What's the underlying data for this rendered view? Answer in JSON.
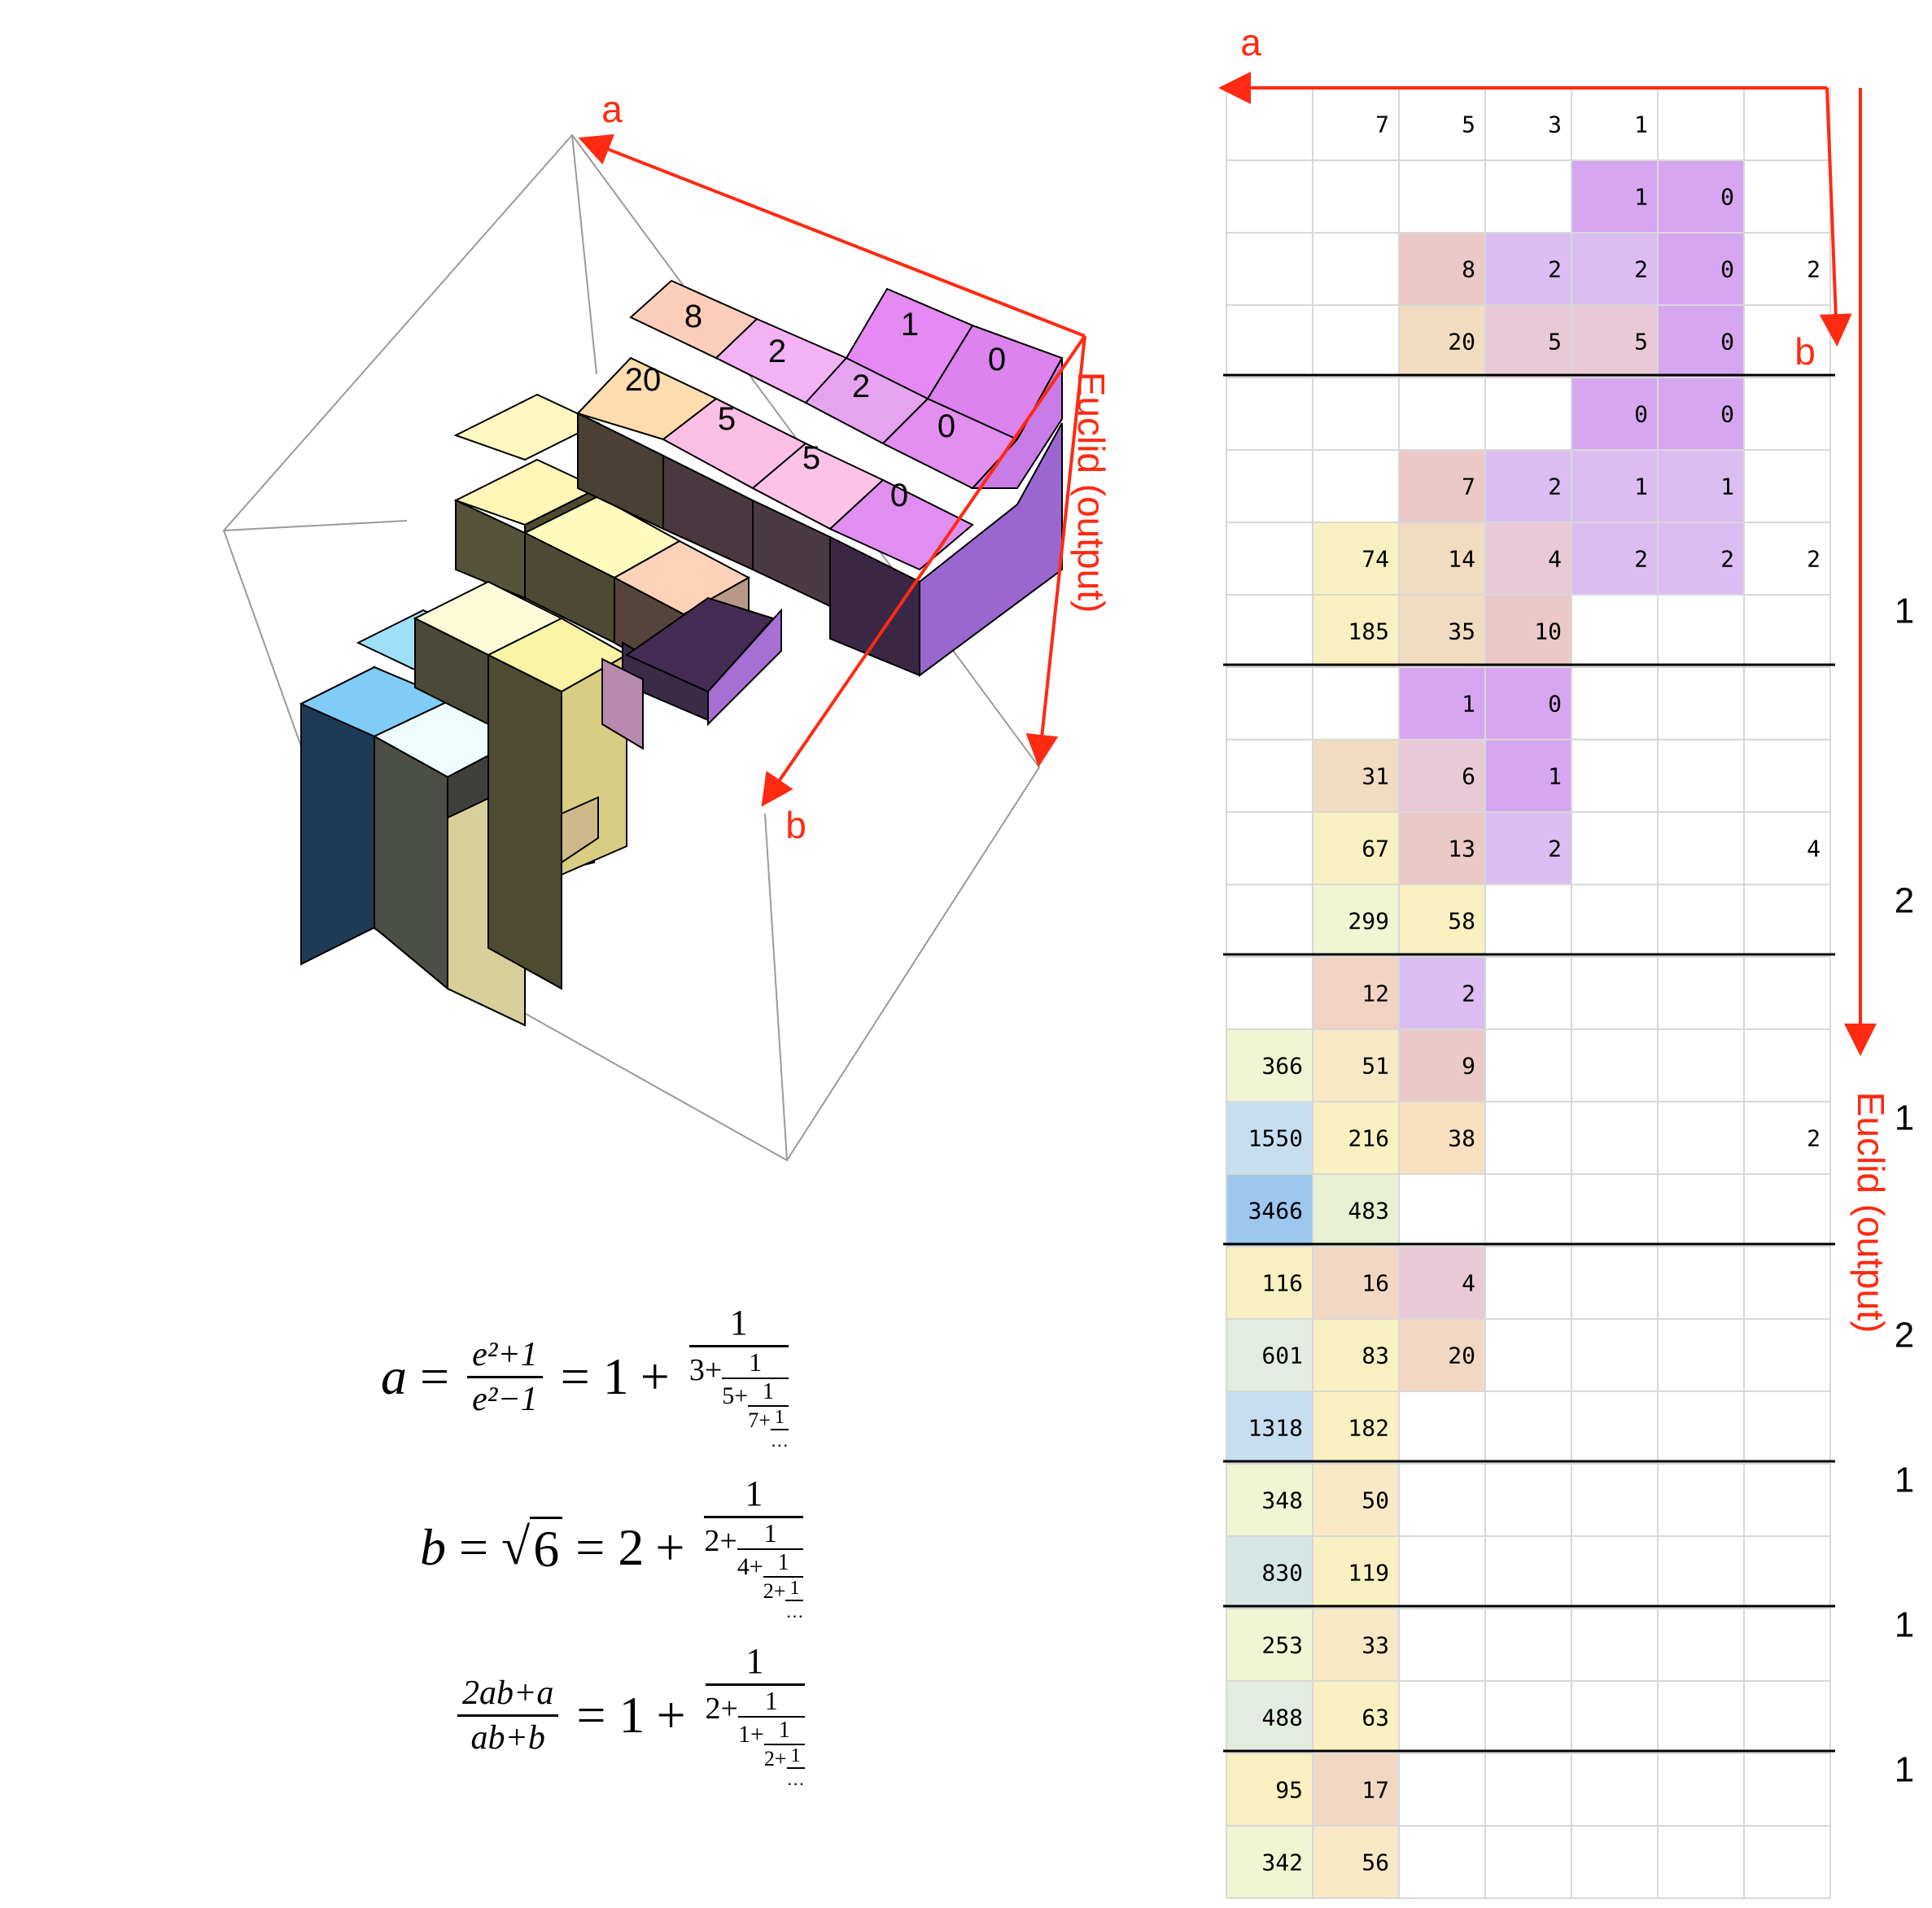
{
  "colors": {
    "red": "#ff2a12",
    "grid_line": "#d8d8d8",
    "block_line": "#000000"
  },
  "cube": {
    "axis_a_label": "a",
    "axis_b_label": "b",
    "axis_euclid_label": "Euclid (output)",
    "top_labels": [
      "8",
      "2",
      "1",
      "0",
      "20",
      "5",
      "2",
      "0",
      "5",
      "0"
    ]
  },
  "formulas": {
    "a": {
      "lhs": "a",
      "eq": "=",
      "num": "e²+1",
      "den": "e²−1",
      "int": "1",
      "plus": "+",
      "one": "1",
      "terms": [
        "3+",
        "5+",
        "7+"
      ],
      "dots": "…"
    },
    "b": {
      "lhs": "b",
      "eq": "=",
      "radicand": "6",
      "int": "2",
      "plus": "+",
      "one": "1",
      "terms": [
        "2+",
        "4+",
        "2+"
      ],
      "dots": "…"
    },
    "c": {
      "num": "2ab+a",
      "den": "ab+b",
      "eq": "=",
      "int": "1",
      "plus": "+",
      "one": "1",
      "terms": [
        "2+",
        "1+",
        "2+"
      ],
      "dots": "…"
    }
  },
  "grid": {
    "axis_a_label": "a",
    "axis_b_label": "b",
    "axis_euclid_label": "Euclid (output)",
    "header": [
      "",
      "7",
      "5",
      "3",
      "1",
      "",
      ""
    ],
    "rows": [
      [
        "",
        "",
        "",
        "",
        "1",
        "0",
        ""
      ],
      [
        "",
        "",
        "8",
        "2",
        "2",
        "0",
        "2"
      ],
      [
        "",
        "",
        "20",
        "5",
        "5",
        "0",
        ""
      ],
      [
        "",
        "",
        "",
        "",
        "0",
        "0",
        ""
      ],
      [
        "",
        "",
        "7",
        "2",
        "1",
        "1",
        ""
      ],
      [
        "",
        "74",
        "14",
        "4",
        "2",
        "2",
        "2"
      ],
      [
        "",
        "185",
        "35",
        "10",
        "",
        "",
        ""
      ],
      [
        "",
        "",
        "1",
        "0",
        "",
        "",
        ""
      ],
      [
        "",
        "31",
        "6",
        "1",
        "",
        "",
        ""
      ],
      [
        "",
        "67",
        "13",
        "2",
        "",
        "",
        "4"
      ],
      [
        "",
        "299",
        "58",
        "",
        "",
        "",
        ""
      ],
      [
        "",
        "12",
        "2",
        "",
        "",
        "",
        ""
      ],
      [
        "366",
        "51",
        "9",
        "",
        "",
        "",
        ""
      ],
      [
        "1550",
        "216",
        "38",
        "",
        "",
        "",
        "2"
      ],
      [
        "3466",
        "483",
        "",
        "",
        "",
        "",
        ""
      ],
      [
        "116",
        "16",
        "4",
        "",
        "",
        "",
        ""
      ],
      [
        "601",
        "83",
        "20",
        "",
        "",
        "",
        ""
      ],
      [
        "1318",
        "182",
        "",
        "",
        "",
        "",
        ""
      ],
      [
        "348",
        "50",
        "",
        "",
        "",
        "",
        ""
      ],
      [
        "830",
        "119",
        "",
        "",
        "",
        "",
        ""
      ],
      [
        "253",
        "33",
        "",
        "",
        "",
        "",
        ""
      ],
      [
        "488",
        "63",
        "",
        "",
        "",
        "",
        ""
      ],
      [
        "95",
        "17",
        "",
        "",
        "",
        "",
        ""
      ],
      [
        "342",
        "56",
        "",
        "",
        "",
        "",
        ""
      ]
    ],
    "row_colors": [
      [
        "",
        "",
        "",
        "",
        "#d7a6f0",
        "#d7a6f0",
        ""
      ],
      [
        "",
        "",
        "#ebc9c8",
        "#dbbdf2",
        "#dbbdf2",
        "#d7a6f0",
        ""
      ],
      [
        "",
        "",
        "#f2dcc1",
        "#e9c9d6",
        "#e9c9d6",
        "#d7a6f0",
        ""
      ],
      [
        "",
        "",
        "",
        "",
        "#d7a6f0",
        "#d7a6f0",
        ""
      ],
      [
        "",
        "",
        "#ebc9c8",
        "#dbbdf2",
        "#dbbdf2",
        "#dbbdf2",
        ""
      ],
      [
        "",
        "#f8f0c0",
        "#f2dcc1",
        "#e9c9d6",
        "#dbbdf2",
        "#dbbdf2",
        ""
      ],
      [
        "",
        "#f8f0c0",
        "#f2dcc1",
        "#ebc9c8",
        "",
        "",
        ""
      ],
      [
        "",
        "",
        "#d7a6f0",
        "#d7a6f0",
        "",
        "",
        ""
      ],
      [
        "",
        "#f2dcc1",
        "#e9c9d6",
        "#d7a6f0",
        "",
        "",
        ""
      ],
      [
        "",
        "#f8f0c0",
        "#ebc9c8",
        "#dbbdf2",
        "",
        "",
        ""
      ],
      [
        "",
        "#f0f5d3",
        "#f8f0c0",
        "",
        "",
        "",
        ""
      ],
      [
        "",
        "#f2d2c2",
        "#dbbdf2",
        "",
        "",
        "",
        ""
      ],
      [
        "#f0f5d3",
        "#f8e8c5",
        "#ebc9c8",
        "",
        "",
        "",
        ""
      ],
      [
        "#c6dff0",
        "#f8f0c0",
        "#f8e0c0",
        "",
        "",
        "",
        ""
      ],
      [
        "#9dc7ef",
        "#e8f0d2",
        "",
        "",
        "",
        "",
        ""
      ],
      [
        "#f8f0c0",
        "#f2d8c3",
        "#e9c9d6",
        "",
        "",
        "",
        ""
      ],
      [
        "#e2ece0",
        "#f8f0c0",
        "#f2d8c3",
        "",
        "",
        "",
        ""
      ],
      [
        "#c6dff0",
        "#f8f0c0",
        "",
        "",
        "",
        "",
        ""
      ],
      [
        "#f0f5d3",
        "#f8e8c5",
        "",
        "",
        "",
        "",
        ""
      ],
      [
        "#d5e7e5",
        "#f8f0c0",
        "",
        "",
        "",
        "",
        ""
      ],
      [
        "#f0f5d3",
        "#f8e8c5",
        "",
        "",
        "",
        "",
        ""
      ],
      [
        "#e2ece0",
        "#f8f0c0",
        "",
        "",
        "",
        "",
        ""
      ],
      [
        "#f8f0c0",
        "#f2d8c3",
        "",
        "",
        "",
        "",
        ""
      ],
      [
        "#f0f5d3",
        "#f8e8c5",
        "",
        "",
        "",
        "",
        ""
      ]
    ],
    "quotients": [
      "1",
      "2",
      "1",
      "2",
      "1",
      "1",
      "1"
    ]
  }
}
